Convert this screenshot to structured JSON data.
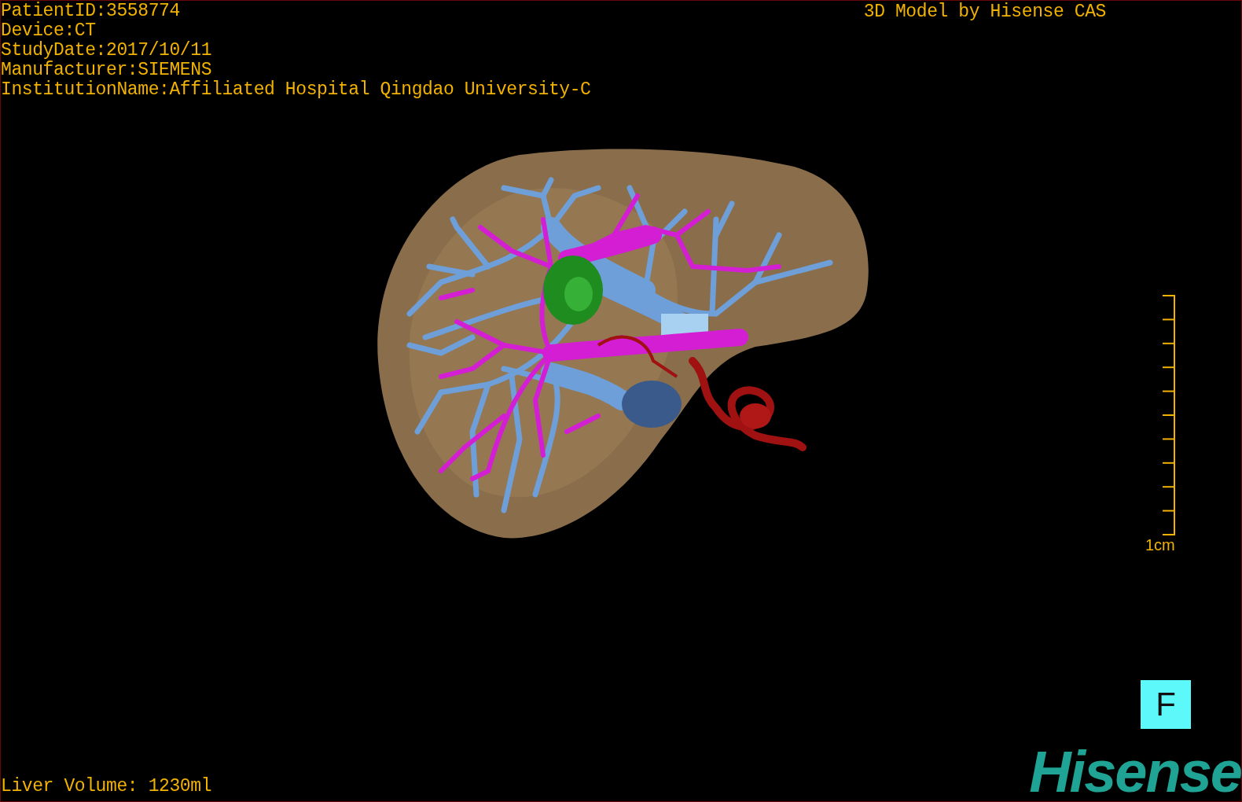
{
  "info_lines": [
    "PatientID:3558774",
    "Device:CT",
    "StudyDate:2017/10/11",
    "Manufacturer:SIEMENS",
    "InstitutionName:Affiliated Hospital Qingdao University-C"
  ],
  "title": "3D Model by Hisense CAS",
  "scale": {
    "label": "1cm"
  },
  "orientation": "F",
  "volume": "Liver Volume: 1230ml",
  "logo": "Hisense"
}
